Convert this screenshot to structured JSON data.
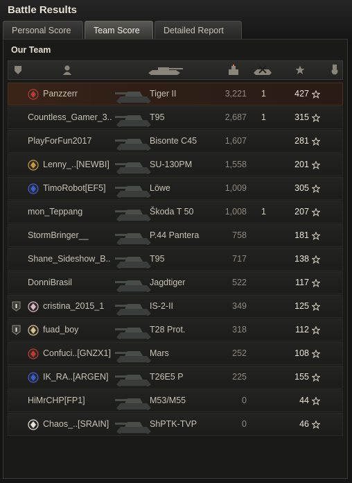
{
  "window": {
    "title": "Battle Results"
  },
  "tabs": [
    {
      "label": "Personal Score",
      "active": false
    },
    {
      "label": "Team Score",
      "active": true
    },
    {
      "label": "Detailed Report",
      "active": false
    }
  ],
  "team": {
    "label": "Our Team"
  },
  "columns": {
    "platoon_icon": "shield-icon",
    "player_icon": "person-icon",
    "vehicle_icon": "tank-icon",
    "damage_icon": "damage-icon",
    "kills_icon": "destroyed-tank-icon",
    "xp_icon": "star-icon",
    "medal_icon": "medal-icon"
  },
  "colors": {
    "accent_orange": "#e07a3a",
    "star": "#cfc9bb",
    "row_highlight": "#3a2418"
  },
  "players": [
    {
      "name": "Panzzerr",
      "badge": "clan-emblem-red",
      "platoon": "",
      "vehicle": "Tiger II",
      "damage": "3,221",
      "kills": "1",
      "xp": "427"
    },
    {
      "name": "Countless_Gamer_3..",
      "badge": "",
      "platoon": "",
      "vehicle": "T95",
      "damage": "2,687",
      "kills": "1",
      "xp": "315"
    },
    {
      "name": "PlayForFun2017",
      "badge": "",
      "platoon": "",
      "vehicle": "Bisonte C45",
      "damage": "1,607",
      "kills": "",
      "xp": "281"
    },
    {
      "name": "Lenny_..[NEWBI]",
      "badge": "clan-emblem-gold",
      "platoon": "",
      "vehicle": "SU-130PM",
      "damage": "1,558",
      "kills": "",
      "xp": "201"
    },
    {
      "name": "TimoRobot[EF5]",
      "badge": "clan-emblem-blue",
      "platoon": "",
      "vehicle": "Löwe",
      "damage": "1,009",
      "kills": "",
      "xp": "305"
    },
    {
      "name": "mon_Teppang",
      "badge": "",
      "platoon": "",
      "vehicle": "Škoda T 50",
      "damage": "1,008",
      "kills": "1",
      "xp": "207"
    },
    {
      "name": "StormBringer__",
      "badge": "",
      "platoon": "",
      "vehicle": "P.44 Pantera",
      "damage": "758",
      "kills": "",
      "xp": "181"
    },
    {
      "name": "Shane_Sideshow_B..",
      "badge": "",
      "platoon": "",
      "vehicle": "T95",
      "damage": "717",
      "kills": "",
      "xp": "138"
    },
    {
      "name": "DonniBrasil",
      "badge": "",
      "platoon": "",
      "vehicle": "Jagdtiger",
      "damage": "522",
      "kills": "",
      "xp": "117"
    },
    {
      "name": "cristina_2015_1",
      "badge": "clan-emblem-pink",
      "platoon": "I",
      "vehicle": "IS-2-II",
      "damage": "349",
      "kills": "",
      "xp": "125"
    },
    {
      "name": "fuad_boy",
      "badge": "clan-emblem-tan",
      "platoon": "I",
      "vehicle": "T28 Prot.",
      "damage": "318",
      "kills": "",
      "xp": "112"
    },
    {
      "name": "Confuci..[GNZX1]",
      "badge": "clan-emblem-red",
      "platoon": "",
      "vehicle": "Mars",
      "damage": "252",
      "kills": "",
      "xp": "108"
    },
    {
      "name": "IK_RA..[ARGEN]",
      "badge": "clan-emblem-blue",
      "platoon": "",
      "vehicle": "T26E5 P",
      "damage": "225",
      "kills": "",
      "xp": "155"
    },
    {
      "name": "HiMrCHP[FP1]",
      "badge": "",
      "platoon": "",
      "vehicle": "M53/M55",
      "damage": "0",
      "kills": "",
      "xp": "44"
    },
    {
      "name": "Chaos_..[SRAIN]",
      "badge": "clan-emblem-white",
      "platoon": "",
      "vehicle": "ShPTK-TVP",
      "damage": "0",
      "kills": "",
      "xp": "46"
    }
  ]
}
